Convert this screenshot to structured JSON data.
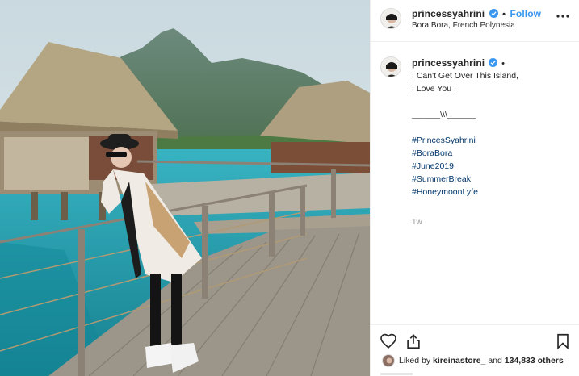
{
  "post": {
    "username": "princessyahrini",
    "follow_label": "Follow",
    "location": "Bora Bora, French Polynesia",
    "caption_lines": [
      "I Can't Get Over This Island,",
      "I Love You !",
      "",
      "______\\\\\\______",
      ""
    ],
    "hashtags": [
      "#PrincesSyahrini",
      "#BoraBora",
      "#June2019",
      "#SummerBreak",
      "#HoneymoonLyfe"
    ],
    "time": "1w",
    "likes": {
      "prefix": "Liked by ",
      "user": "kireinastore_",
      "middle": " and ",
      "count": "134,833 others"
    }
  },
  "icons": {
    "verified": "verified-badge-icon",
    "more": "more-options-icon",
    "like": "heart-icon",
    "share": "share-icon",
    "save": "bookmark-icon"
  },
  "colors": {
    "accent": "#3897f0",
    "hashtag": "#003569",
    "muted": "#999999",
    "divider": "#efefef"
  }
}
